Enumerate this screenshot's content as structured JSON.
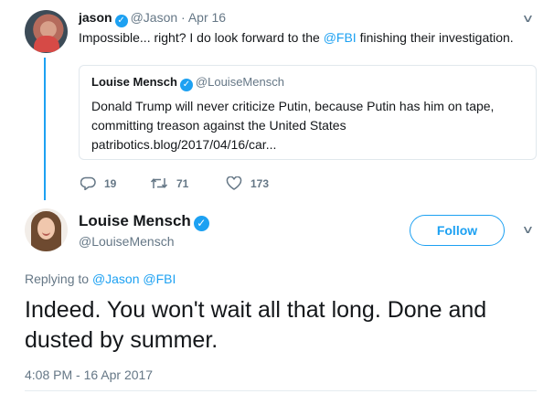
{
  "parent_tweet": {
    "name": "jason",
    "handle": "@Jason",
    "separator": "·",
    "date": "Apr 16",
    "text_before": "Impossible... right? I do look forward to the ",
    "mention": "@FBI",
    "text_after": " finishing their investigation.",
    "quoted": {
      "name": "Louise Mensch",
      "handle": "@LouiseMensch",
      "text": "Donald Trump will never criticize Putin, because Putin has him on tape, committing treason against the United States patribotics.blog/2017/04/16/car..."
    },
    "actions": {
      "replies": "19",
      "retweets": "71",
      "likes": "173"
    }
  },
  "main_tweet": {
    "name": "Louise Mensch",
    "handle": "@LouiseMensch",
    "follow_label": "Follow",
    "replying_prefix": "Replying to ",
    "replying_to": [
      "@Jason",
      "@FBI"
    ],
    "text": "Indeed. You won't wait all that long. Done and dusted by summer.",
    "timestamp": "4:08 PM - 16 Apr 2017"
  },
  "colors": {
    "accent": "#1da1f2",
    "secondary_text": "#657786",
    "primary_text": "#14171a",
    "border": "#e1e8ed"
  },
  "icons": {
    "verified": "verified-badge-icon",
    "more": "chevron-down-icon",
    "reply": "reply-icon",
    "retweet": "retweet-icon",
    "like": "heart-icon"
  }
}
